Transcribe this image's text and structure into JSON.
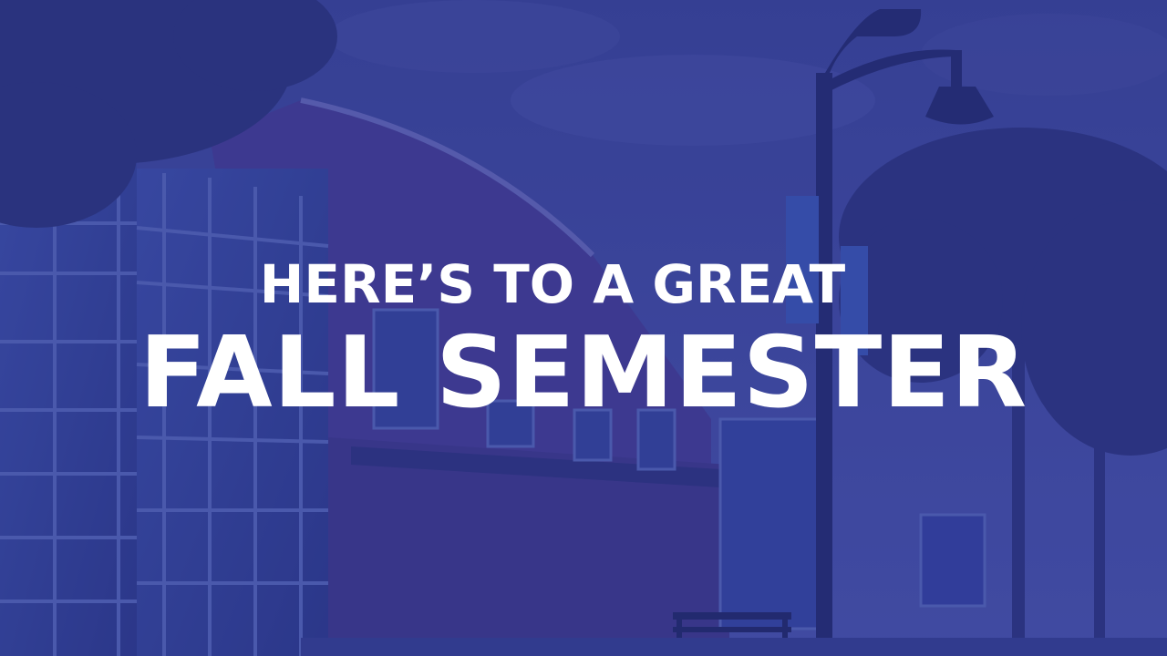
{
  "headline": {
    "line1": "HERE’S TO A GREAT",
    "line2": "FALL SEMESTER"
  },
  "overlay": {
    "tint_color": "#2f3a9a",
    "text_color": "#ffffff"
  },
  "icons": [
    "street-lamp-icon",
    "banner-flag-icon",
    "bench-icon"
  ]
}
